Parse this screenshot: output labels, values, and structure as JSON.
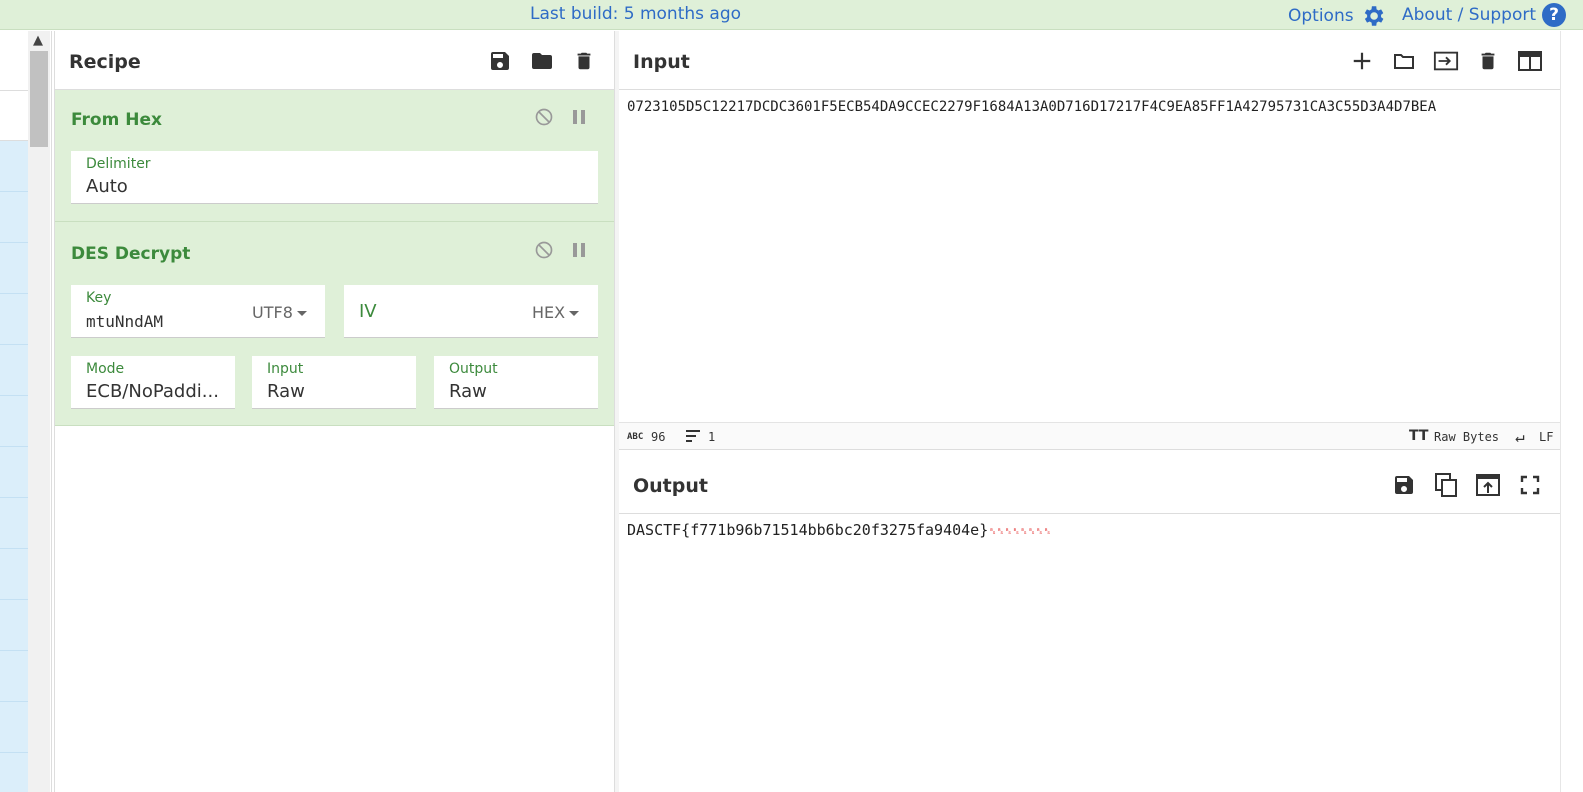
{
  "topbar": {
    "build_text": "Last build: 5 months ago",
    "options_label": "Options",
    "about_label": "About / Support",
    "help_glyph": "?",
    "accent": "#2e6bc6"
  },
  "recipe": {
    "title": "Recipe",
    "icons": [
      "save-icon",
      "folder-icon",
      "trash-icon"
    ],
    "operations": [
      {
        "name": "From Hex",
        "fields": {
          "delimiter_label": "Delimiter",
          "delimiter_value": "Auto"
        }
      },
      {
        "name": "DES Decrypt",
        "fields": {
          "key_label": "Key",
          "key_value": "mtuNndAM",
          "key_encoding": "UTF8",
          "iv_label": "IV",
          "iv_encoding": "HEX",
          "mode_label": "Mode",
          "mode_value": "ECB/NoPaddi...",
          "input_label": "Input",
          "input_value": "Raw",
          "output_label": "Output",
          "output_value": "Raw"
        }
      }
    ]
  },
  "input": {
    "title": "Input",
    "text": "0723105D5C12217DCDC3601F5ECB54DA9CCEC2279F1684A13A0D716D17217F4C9EA85FF1A42795731CA3C55D3A4D7BEA",
    "status": {
      "abc_glyph": "ABC",
      "length": "96",
      "lines": "1",
      "encoding": "Raw Bytes",
      "eol": "LF"
    }
  },
  "output": {
    "title": "Output",
    "text": "DASCTF{f771b96b71514bb6bc20f3275fa9404e}",
    "control_chars": "␈␈␈␈␈␈␈␈"
  }
}
